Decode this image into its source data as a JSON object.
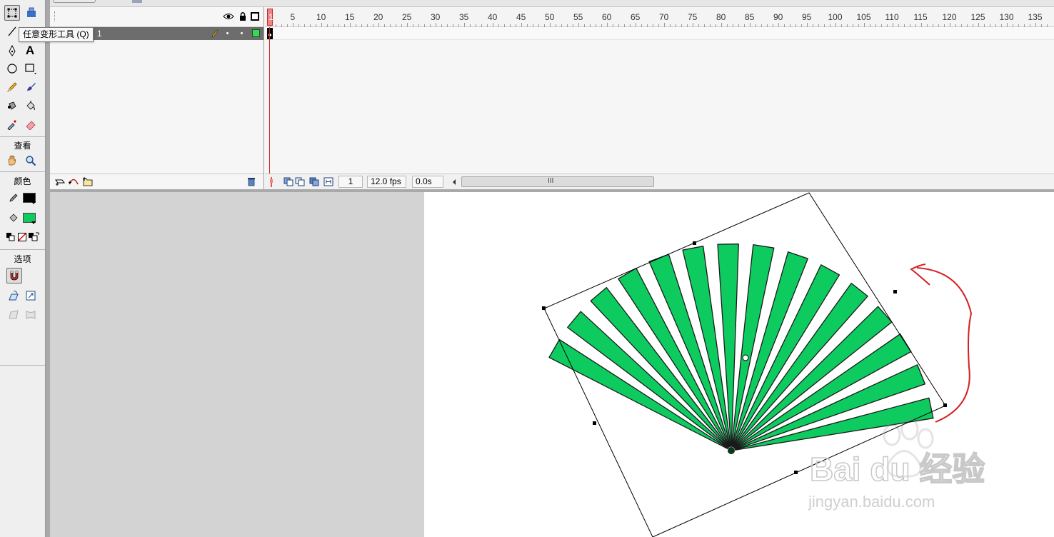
{
  "tools": {
    "tooltip": "任意变形工具 (Q)",
    "section_view": "查看",
    "section_color": "颜色",
    "section_options": "选项",
    "text_tool_glyph": "A",
    "stroke_color": "#000000",
    "fill_color": "#0ecb60"
  },
  "timeline": {
    "layer_name": "1",
    "frame_ticks": [
      "1",
      "5",
      "10",
      "15",
      "20",
      "25",
      "30",
      "35",
      "40",
      "45",
      "50",
      "55",
      "60",
      "65",
      "70",
      "75",
      "80",
      "85",
      "90",
      "95",
      "100",
      "105",
      "110",
      "115",
      "120",
      "125",
      "130",
      "135"
    ],
    "current_frame": "1",
    "fps": "12.0 fps",
    "elapsed": "0.0s",
    "scroll_grip": "III"
  },
  "stage": {
    "shape_color": "#0ecb60",
    "outline_color": "#1a1a1a",
    "annotation_color": "#d42020",
    "watermark_logo": "Bai du 经验",
    "watermark_url": "jingyan.baidu.com"
  }
}
